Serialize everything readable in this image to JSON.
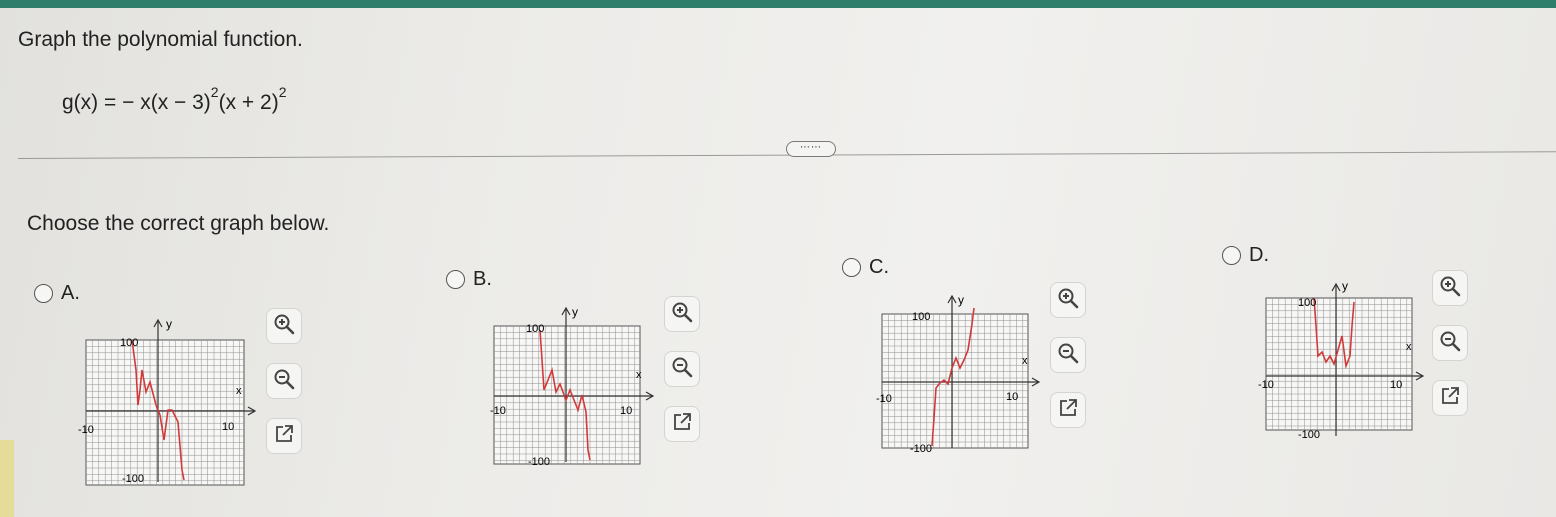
{
  "question": {
    "title": "Graph the polynomial function.",
    "function_main": "g(x) = − x(x − 3)",
    "exp1": "2",
    "function_mid": "(x + 2)",
    "exp2": "2"
  },
  "expand_button": "⋯⋯",
  "instruction": "Choose the correct graph below.",
  "options": [
    {
      "letter": "A.",
      "axis_labels": {
        "y_top": "100",
        "y_bottom": "-100",
        "x_left": "-10",
        "x_right": "10",
        "x": "x",
        "y": "y"
      }
    },
    {
      "letter": "B.",
      "axis_labels": {
        "y_top": "100",
        "y_bottom": "-100",
        "x_left": "-10",
        "x_right": "10",
        "x": "x",
        "y": "y"
      }
    },
    {
      "letter": "C.",
      "axis_labels": {
        "y_top": "100",
        "y_bottom": "-100",
        "x_left": "-10",
        "x_right": "10",
        "x": "x",
        "y": "y"
      }
    },
    {
      "letter": "D.",
      "axis_labels": {
        "y_top": "100",
        "y_bottom": "-100",
        "x_left": "-10",
        "x_right": "10",
        "x": "x",
        "y": "y"
      }
    }
  ],
  "tool_icons": [
    "zoom-in-icon",
    "zoom-out-icon",
    "open-external-icon"
  ],
  "colors": {
    "curve": "#d23a3a",
    "grid": "#8f8f8f",
    "accent": "#2f7d6b"
  }
}
